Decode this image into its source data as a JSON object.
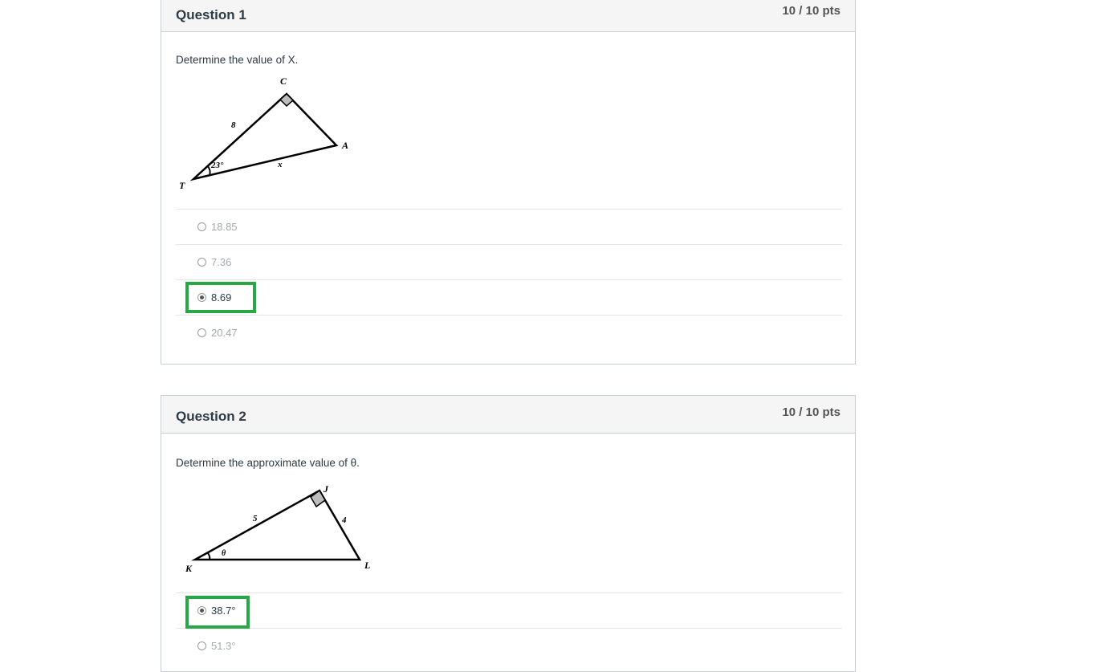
{
  "questions": [
    {
      "title": "Question 1",
      "points": "10 / 10 pts",
      "prompt": "Determine the value of X.",
      "figure": {
        "vertex_labels": [
          "C",
          "A",
          "T"
        ],
        "side_labels": [
          "8",
          "x"
        ],
        "angle_label": "23°"
      },
      "answers": [
        {
          "label": "18.85",
          "selected": false
        },
        {
          "label": "7.36",
          "selected": false
        },
        {
          "label": "8.69",
          "selected": true
        },
        {
          "label": "20.47",
          "selected": false
        }
      ]
    },
    {
      "title": "Question 2",
      "points": "10 / 10 pts",
      "prompt": "Determine the approximate value of θ.",
      "figure": {
        "vertex_labels": [
          "J",
          "K",
          "L"
        ],
        "side_labels": [
          "5",
          "4"
        ],
        "angle_label": "θ"
      },
      "answers": [
        {
          "label": "38.7°",
          "selected": true
        },
        {
          "label": "51.3°",
          "selected": false
        }
      ]
    }
  ],
  "colors": {
    "highlight": "#28a745",
    "header_bg": "#f5f5f5",
    "border": "#c7cdd1"
  }
}
